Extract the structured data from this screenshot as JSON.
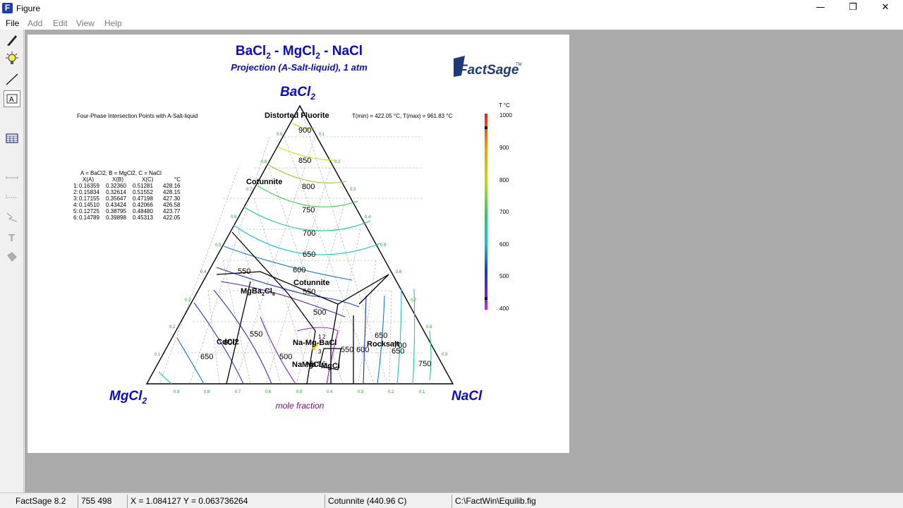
{
  "window": {
    "title": "Figure",
    "app_icon_letter": "F",
    "minimize_glyph": "—",
    "maximize_glyph": "❐",
    "close_glyph": "✕"
  },
  "menu": [
    {
      "label": "File",
      "enabled": true
    },
    {
      "label": "Add",
      "enabled": false
    },
    {
      "label": "Edit",
      "enabled": false
    },
    {
      "label": "View",
      "enabled": false
    },
    {
      "label": "Help",
      "enabled": false
    }
  ],
  "toolbar": {
    "tools": [
      "pen-icon",
      "lightbulb-icon",
      "line-icon",
      "text-box-icon",
      "table-icon",
      "line-style-1-icon",
      "line-style-2-icon",
      "curve-icon",
      "text-icon",
      "fill-icon"
    ],
    "text_box_glyph": "A",
    "text_glyph": "T"
  },
  "figure": {
    "title_base": [
      "BaCl",
      " - MgCl",
      " - NaCl"
    ],
    "title_subscript": "2",
    "subtitle": "Projection (A-Salt-liquid), 1 atm",
    "logo_text": "FactSage",
    "logo_tm": "TM",
    "corner_top": "BaCl",
    "corner_left": "MgCl",
    "corner_right": "NaCl",
    "corner_subscript": "2",
    "axis_label": "mole fraction",
    "info_left": "Four-Phase Intersection Points with A-Salt-liquid",
    "info_right": "T(min) = 422.05 °C, T(max) = 961.83 °C",
    "legend_header": "A = BaCl2,  B = MgCl2,  C = NaCl",
    "column_headers": [
      "X(A)",
      "X(B)",
      "X(C)",
      "°C"
    ],
    "points": [
      {
        "id": "1:",
        "xa": "0.16359",
        "xb": "0.32360",
        "xc": "0.51281",
        "t": "428.16"
      },
      {
        "id": "2:",
        "xa": "0.15834",
        "xb": "0.32614",
        "xc": "0.51552",
        "t": "428.15"
      },
      {
        "id": "3:",
        "xa": "0.17155",
        "xb": "0.35647",
        "xc": "0.47198",
        "t": "427.30"
      },
      {
        "id": "4:",
        "xa": "0.14510",
        "xb": "0.43424",
        "xc": "0.42066",
        "t": "426.58"
      },
      {
        "id": "5:",
        "xa": "0.12725",
        "xb": "0.38795",
        "xc": "0.48480",
        "t": "423.77"
      },
      {
        "id": "6:",
        "xa": "0.14789",
        "xb": "0.39898",
        "xc": "0.45313",
        "t": "422.05"
      }
    ],
    "colorbar_unit": "T °C",
    "colorbar_ticks": [
      "1000",
      "900",
      "800",
      "700",
      "600",
      "500",
      "400"
    ],
    "bottom_ticks": [
      "0.9",
      "0.8",
      "0.7",
      "0.6",
      "0.5",
      "0.4",
      "0.3",
      "0.2",
      "0.1"
    ],
    "left_ticks": [
      "0.1",
      "0.2",
      "0.3",
      "0.4",
      "0.5",
      "0.6",
      "0.7",
      "0.8",
      "0.9"
    ],
    "right_ticks": [
      "0.1",
      "0.2",
      "0.3",
      "0.4",
      "0.5",
      "0.6",
      "0.7",
      "0.8",
      "0.9"
    ],
    "isotherm_labels": [
      "900",
      "850",
      "800",
      "750",
      "700",
      "650",
      "600",
      "550",
      "500",
      "550",
      "550",
      "600",
      "650",
      "650",
      "500",
      "550",
      "650",
      "700",
      "750",
      "600"
    ],
    "phase_labels": [
      "Distorted Fluorite",
      "Cotunnite",
      "Cotunnite",
      "MgBa",
      "CdCl2",
      "Na-Mg-BaCl",
      "Rocksalt",
      "NaMgCl",
      "Na",
      "MgCl"
    ],
    "phase_subscripts": [
      "2",
      "6"
    ],
    "point_numbers": [
      "1",
      "2",
      "3",
      "4",
      "5",
      "6"
    ],
    "colors": {
      "title": "#0a0ad2",
      "subtitle": "#0a0ad2",
      "axis_label": "#7a0a8a",
      "tick_green": "#2a9a2a"
    }
  },
  "status": {
    "app": "FactSage 8.2",
    "pixel": "755  498",
    "coords": "X = 1.084127  Y = 0.063736264",
    "phase": "Cotunnite  (440.96 C)",
    "file": "C:\\FactWin\\Equilib.fig"
  }
}
